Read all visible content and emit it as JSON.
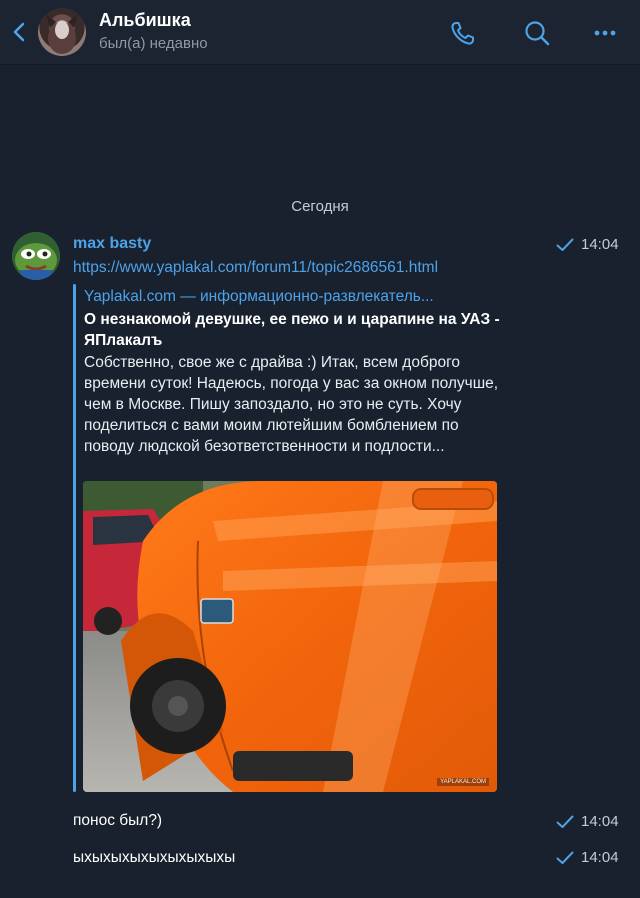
{
  "header": {
    "title": "Альбишка",
    "status": "был(а) недавно"
  },
  "date_separator": "Сегодня",
  "messages": [
    {
      "sender": "max basty",
      "time": "14:04",
      "link": "https://www.yaplakal.com/forum11/topic2686561.html",
      "preview": {
        "site": "Yaplakal.com — информационно-развлекатель...",
        "title": "О незнакомой девушке, ее пежо и и царапине на УАЗ - ЯПлакалъ",
        "description": "Собственно, свое же с драйва :)  Итак, всем доброго времени суток! Надеюсь, погода у вас за окном получше, чем в Москве.  Пишу запоздало, но это не суть.  Хочу поделиться с вами моим лютейшим бомблением по поводу людской безответственности и подлости...",
        "image_watermark": "YAPLAKAL.COM"
      }
    },
    {
      "text": "понос был?)",
      "time": "14:04"
    },
    {
      "text": "ыхыхыхыхыхыхыхыхы",
      "time": "14:04"
    }
  ],
  "colors": {
    "background": "#18212d",
    "header": "#1b2430",
    "accent": "#4ea2e8",
    "secondary_text": "#8e9aa7"
  },
  "icons": [
    "back-chevron-icon",
    "phone-icon",
    "search-icon",
    "more-icon",
    "checkmark-icon"
  ]
}
